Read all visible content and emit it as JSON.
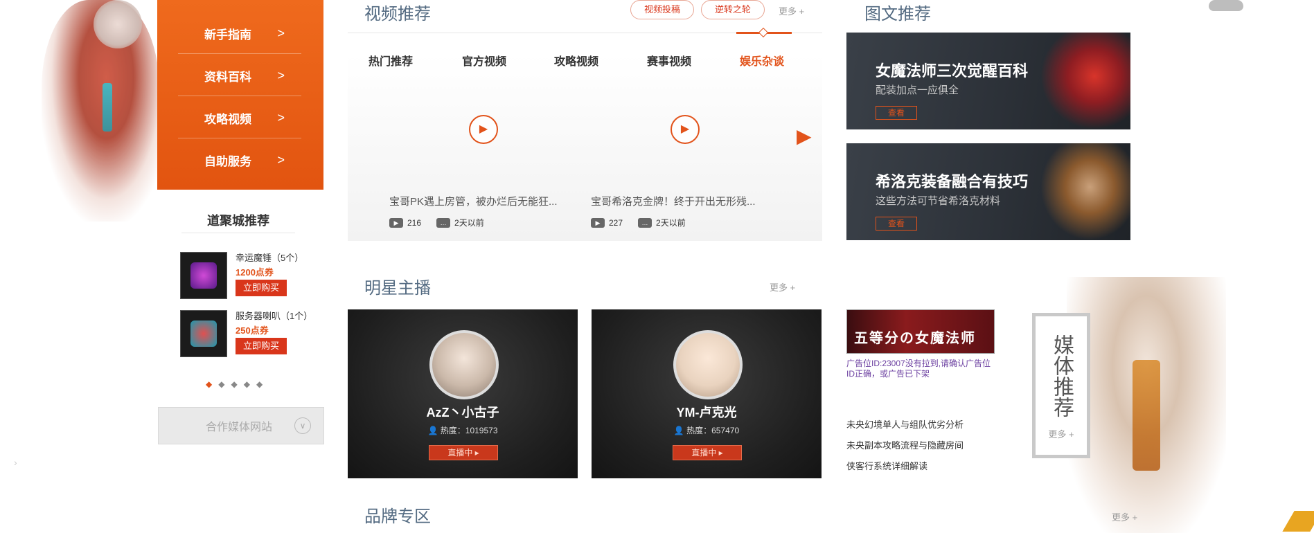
{
  "sidebar": {
    "items": [
      {
        "label": "新手指南",
        "arrow": ">"
      },
      {
        "label": "资料百科",
        "arrow": ">"
      },
      {
        "label": "攻略视频",
        "arrow": ">"
      },
      {
        "label": "自助服务",
        "arrow": ">"
      }
    ]
  },
  "mall": {
    "title": "道聚城推荐",
    "items": [
      {
        "name": "幸运魔锤（5个）",
        "price": "1200点券",
        "buy": "立即购买",
        "icon_color": "#7b2fb5"
      },
      {
        "name": "服务器喇叭（1个）",
        "price": "250点券",
        "buy": "立即购买",
        "icon_color": "#1a9ab0"
      }
    ],
    "dots": [
      "◆",
      "◆",
      "◆",
      "◆",
      "◆"
    ]
  },
  "partner": {
    "label": "合作媒体网站",
    "icon": "∨"
  },
  "video": {
    "title": "视频推荐",
    "buttons": [
      "视频投稿",
      "逆转之轮"
    ],
    "more": "更多 +",
    "tabs": [
      "热门推荐",
      "官方视频",
      "攻略视频",
      "赛事视频",
      "娱乐杂谈"
    ],
    "active_tab": 4,
    "items": [
      {
        "caption": "宝哥PK遇上房管，被办烂后无能狂...",
        "plays": "216",
        "time": "2天以前"
      },
      {
        "caption": "宝哥希洛克金牌！终于开出无形残...",
        "plays": "227",
        "time": "2天以前"
      }
    ]
  },
  "tuwen": {
    "title": "图文推荐",
    "cards": [
      {
        "title": "女魔法师三次觉醒百科",
        "subtitle": "配装加点一应俱全",
        "button": "查看"
      },
      {
        "title": "希洛克装备融合有技巧",
        "subtitle": "这些方法可节省希洛克材料",
        "button": "查看"
      }
    ]
  },
  "stars": {
    "title": "明星主播",
    "more": "更多 +",
    "streamers": [
      {
        "name": "AzZ丶小古子",
        "heat_label": "热度：",
        "heat": "1019573",
        "live": "直播中 ▸"
      },
      {
        "name": "YM-卢克光",
        "heat_label": "热度：",
        "heat": "657470",
        "live": "直播中 ▸"
      }
    ]
  },
  "ad": {
    "banner_text": "五等分の女魔法师",
    "note": "广告位ID:23007没有拉到,请确认广告位ID正确，或广告已下架"
  },
  "news": [
    "未央幻境单人与组队优劣分析",
    "未央副本攻略流程与隐藏房间",
    "侠客行系统详细解读"
  ],
  "media": {
    "title": "媒体推荐",
    "more": "更多 +"
  },
  "brand": {
    "title": "品牌专区",
    "more": "更多 +"
  },
  "colors": {
    "accent": "#e2531b",
    "nav": "#e85a14",
    "title": "#546b82"
  }
}
